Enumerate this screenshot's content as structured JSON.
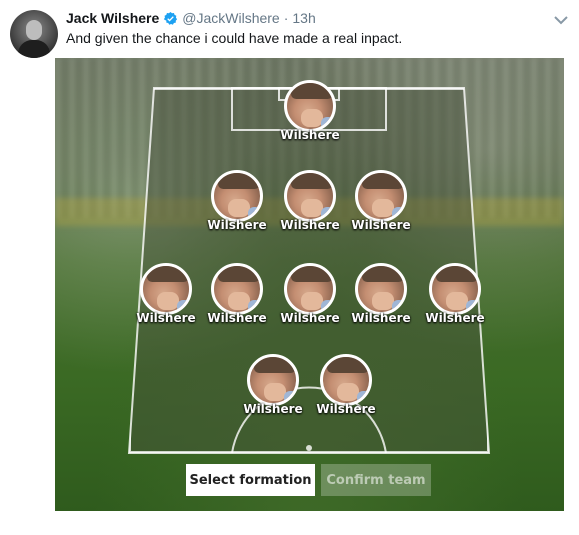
{
  "tweet": {
    "display_name": "Jack Wilshere",
    "verified_icon": "verified-badge-icon",
    "handle": "@JackWilshere",
    "separator": "·",
    "time": "13h",
    "text": "And given the chance i could have made a real inpact.",
    "menu_icon": "chevron-down-icon"
  },
  "formation": {
    "players": [
      {
        "name": "Wilshere",
        "position": "GK"
      },
      {
        "name": "Wilshere",
        "position": "LCB"
      },
      {
        "name": "Wilshere",
        "position": "CB"
      },
      {
        "name": "Wilshere",
        "position": "RCB"
      },
      {
        "name": "Wilshere",
        "position": "LM"
      },
      {
        "name": "Wilshere",
        "position": "LCM"
      },
      {
        "name": "Wilshere",
        "position": "CM"
      },
      {
        "name": "Wilshere",
        "position": "RCM"
      },
      {
        "name": "Wilshere",
        "position": "RM"
      },
      {
        "name": "Wilshere",
        "position": "LF"
      },
      {
        "name": "Wilshere",
        "position": "RF"
      }
    ],
    "select_button": "Select formation",
    "confirm_button": "Confirm team"
  },
  "colors": {
    "verified": "#1da1f2",
    "muted_text": "#657786",
    "pitch_line": "#ffffff"
  }
}
